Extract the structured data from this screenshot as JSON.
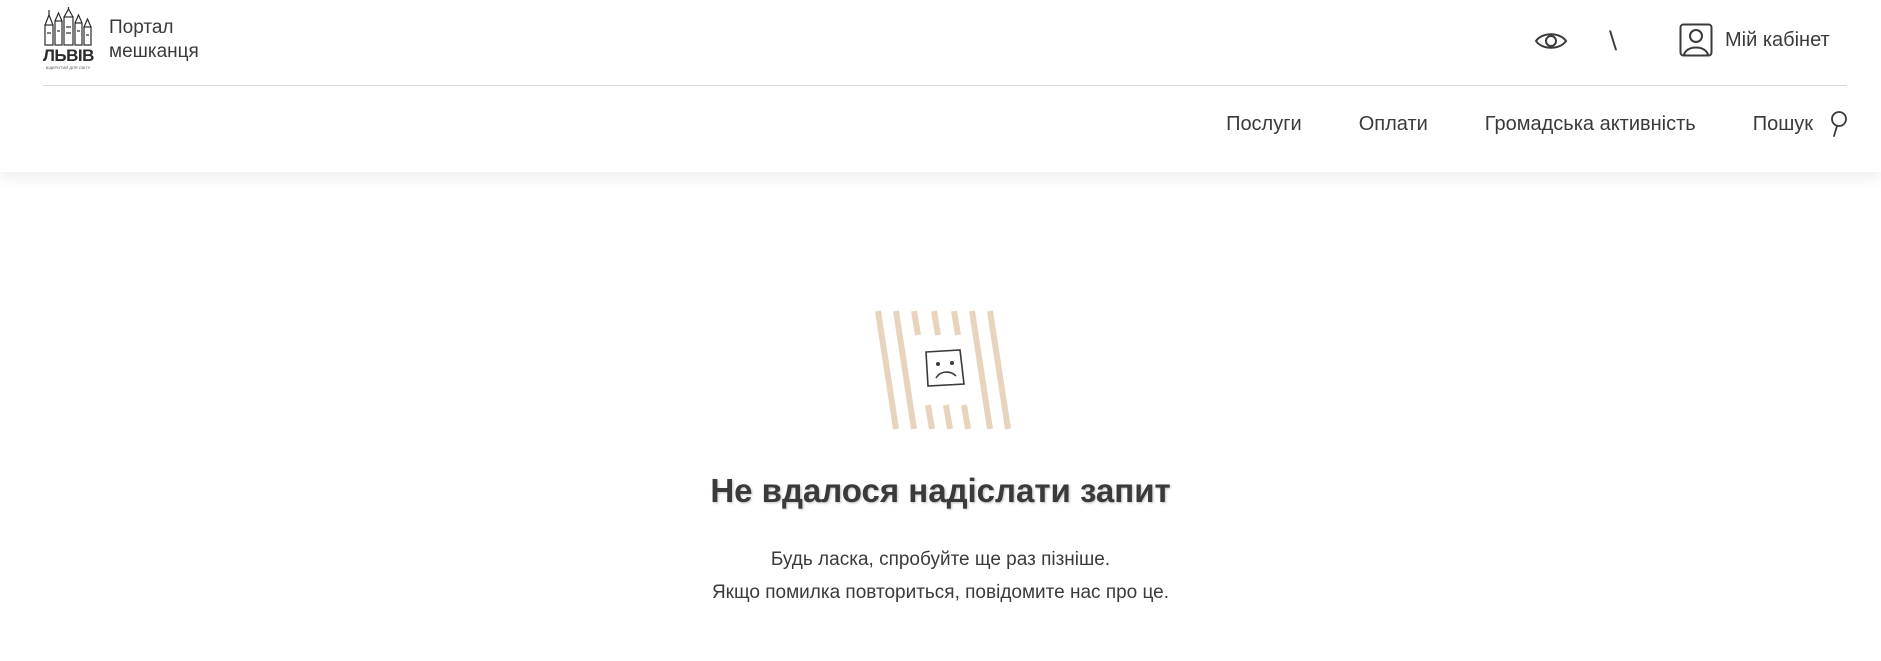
{
  "header": {
    "logo": {
      "word": "ЛЬВІВ",
      "tagline": "ВІДКРИТИЙ ДЛЯ СВІТУ",
      "icon": "lviv-city-skyline-logo"
    },
    "portal_title_line1": "Портал",
    "portal_title_line2": "мешканця",
    "accessibility_icon": "eye-icon",
    "separator": "\\",
    "cabinet": {
      "icon": "user-portrait-icon",
      "label": "Мій кабінет"
    },
    "nav": {
      "items": [
        {
          "label": "Послуги"
        },
        {
          "label": "Оплати"
        },
        {
          "label": "Громадська активність"
        }
      ],
      "search_label": "Пошук",
      "search_icon": "search-icon"
    }
  },
  "error": {
    "illustration_icon": "sad-face-striped-icon",
    "title": "Не вдалося надіслати запит",
    "line1": "Будь ласка, спробуйте ще раз пізніше.",
    "line2": "Якщо помилка повториться, повідомите нас про це."
  },
  "colors": {
    "stripe_accent": "#e8d3bd",
    "text": "#3a3a3a",
    "divider": "#d9d9d9"
  }
}
